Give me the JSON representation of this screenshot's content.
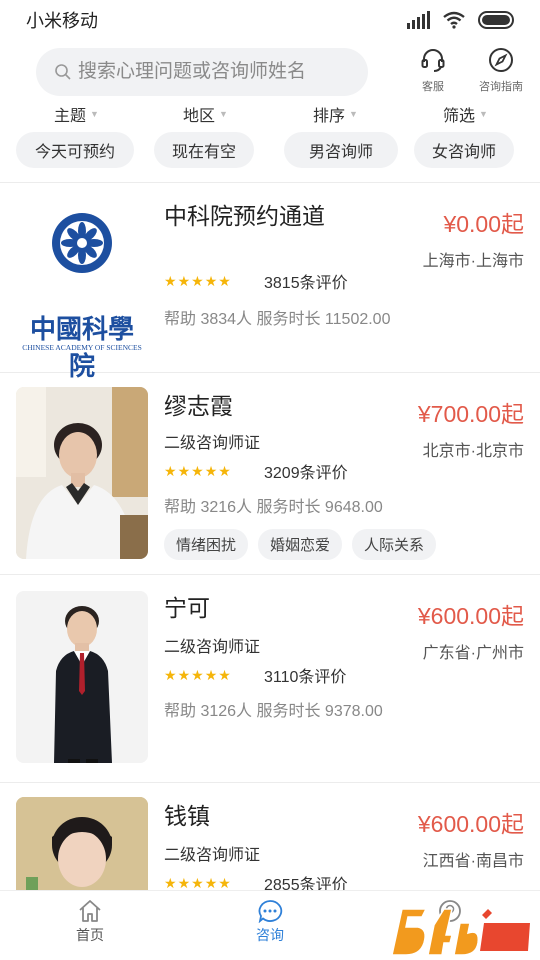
{
  "status_bar": {
    "carrier": "小米移动"
  },
  "search": {
    "placeholder": "搜索心理问题或咨询师姓名"
  },
  "top_actions": {
    "service": "客服",
    "guide": "咨询指南"
  },
  "filter_tabs": [
    "主题",
    "地区",
    "排序",
    "筛选"
  ],
  "quick_filters": [
    "今天可预约",
    "现在有空",
    "男咨询师",
    "女咨询师"
  ],
  "counselors": [
    {
      "name": "中科院预约通道",
      "price": "¥0.00起",
      "location": "上海市·上海市",
      "reviews": "3815条评价",
      "help": "帮助 3834人 服务时长 11502.00",
      "logo_text": "中國科學院",
      "logo_subtext": "CHINESE ACADEMY OF SCIENCES",
      "stars": 5
    },
    {
      "name": "缪志霞",
      "price": "¥700.00起",
      "location": "北京市·北京市",
      "cert": "二级咨询师证",
      "reviews": "3209条评价",
      "help": "帮助 3216人 服务时长 9648.00",
      "tags": [
        "情绪困扰",
        "婚姻恋爱",
        "人际关系"
      ],
      "stars": 5
    },
    {
      "name": "宁可",
      "price": "¥600.00起",
      "location": "广东省·广州市",
      "cert": "二级咨询师证",
      "reviews": "3110条评价",
      "help": "帮助 3126人 服务时长 9378.00",
      "stars": 5
    },
    {
      "name": "钱镇",
      "price": "¥600.00起",
      "location": "江西省·南昌市",
      "cert": "二级咨询师证",
      "reviews": "2855条评价",
      "stars": 5
    }
  ],
  "bottom_nav": [
    {
      "label": "首页",
      "icon": "home-icon",
      "active": false
    },
    {
      "label": "咨询",
      "icon": "chat-icon",
      "active": true
    }
  ],
  "watermark": {
    "text": "54qb手游网",
    "sub": ".com.cn"
  },
  "colors": {
    "accent": "#2f80d8",
    "price": "#e25a4a",
    "star": "#f5b50a",
    "chip_bg": "#f1f2f4"
  }
}
